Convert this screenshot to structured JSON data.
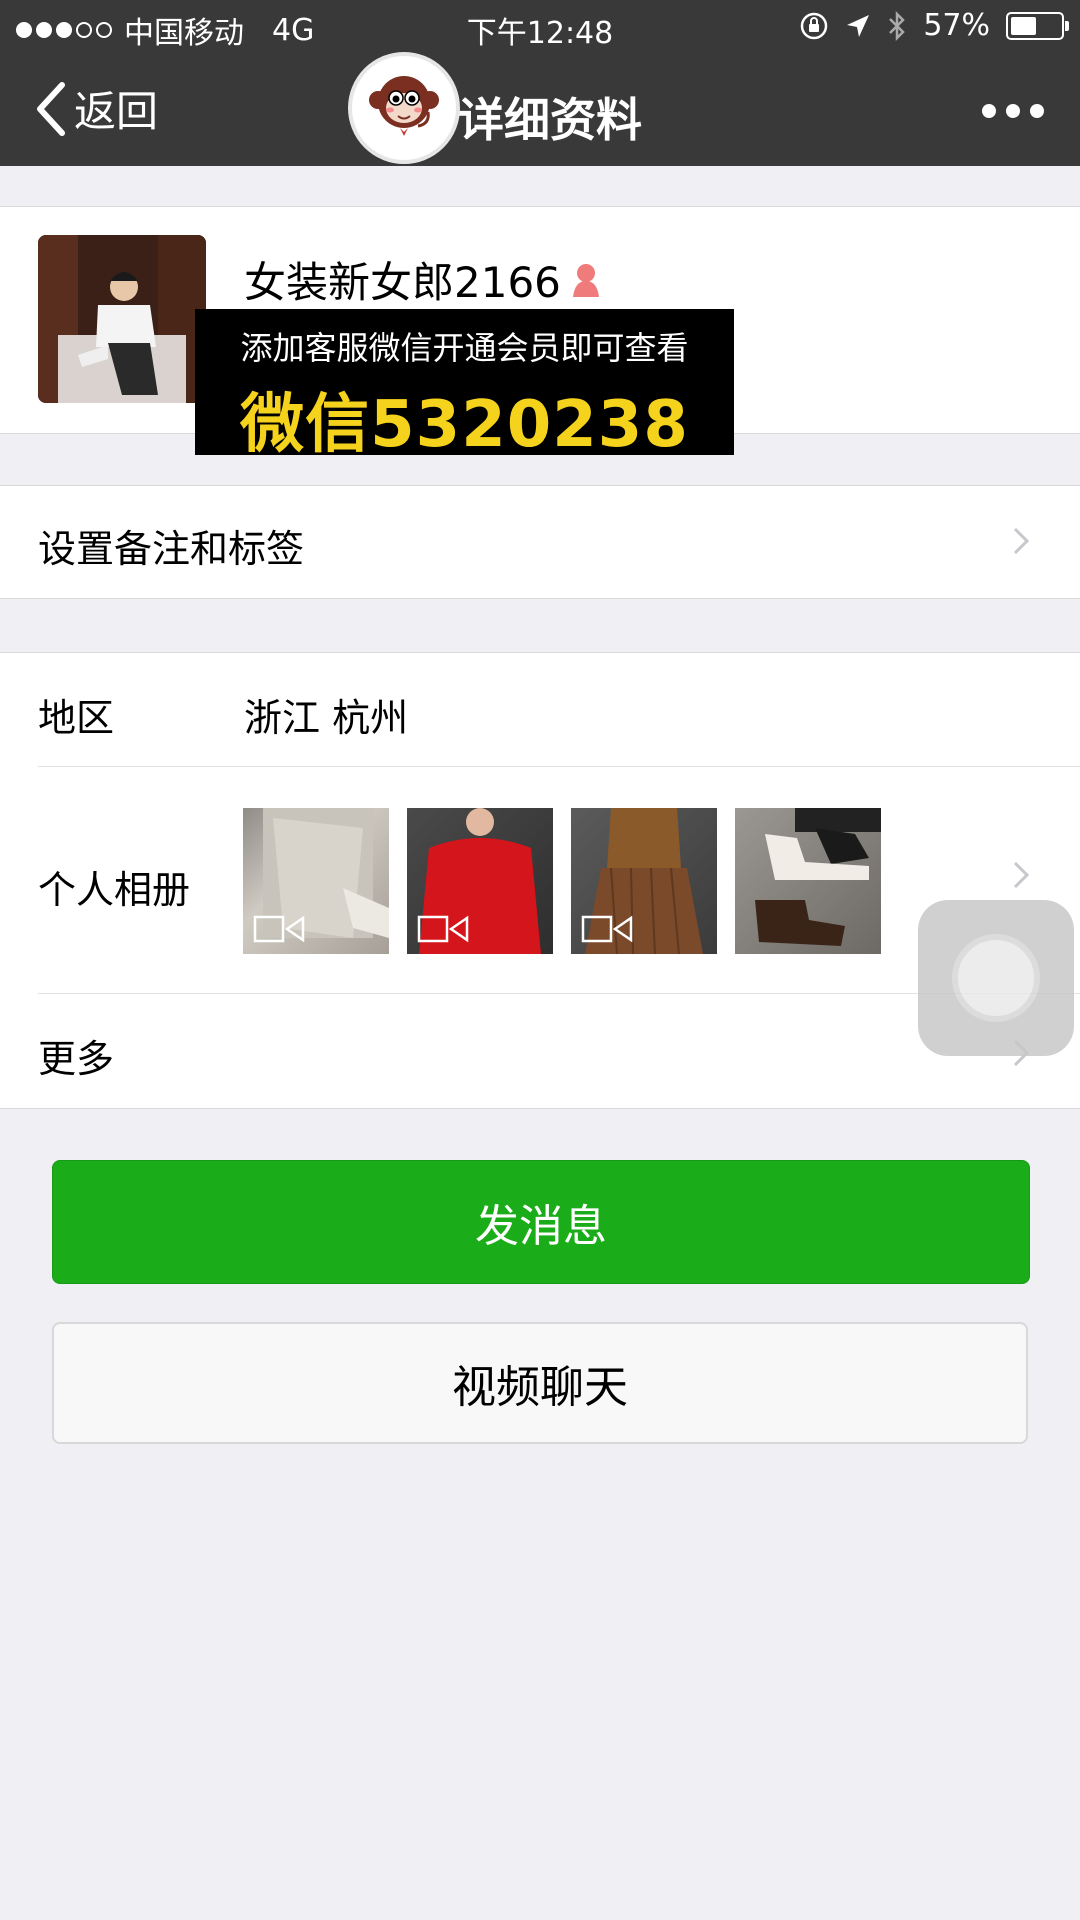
{
  "status_bar": {
    "carrier": "中国移动",
    "network": "4G",
    "time": "下午12:48",
    "battery_percent": "57%",
    "battery_level": 0.57,
    "signal_bars": 3,
    "signal_total": 5
  },
  "nav": {
    "back_label": "返回",
    "title": "详细资料",
    "logo_name": "monkey-logo"
  },
  "profile": {
    "nickname": "女装新女郎2166",
    "gender_icon": "female-icon",
    "banner_line1": "添加客服微信开通会员即可查看",
    "banner_line2": "微信5320238"
  },
  "remark": {
    "label": "设置备注和标签"
  },
  "info": {
    "region_label": "地区",
    "region_value": "浙江 杭州",
    "album_label": "个人相册",
    "more_label": "更多"
  },
  "buttons": {
    "send_message": "发消息",
    "video_chat": "视频聊天"
  },
  "colors": {
    "nav_bg": "#39393a",
    "page_bg": "#efeff4",
    "primary_green": "#1aad19",
    "banner_yellow": "#f5d21c"
  }
}
